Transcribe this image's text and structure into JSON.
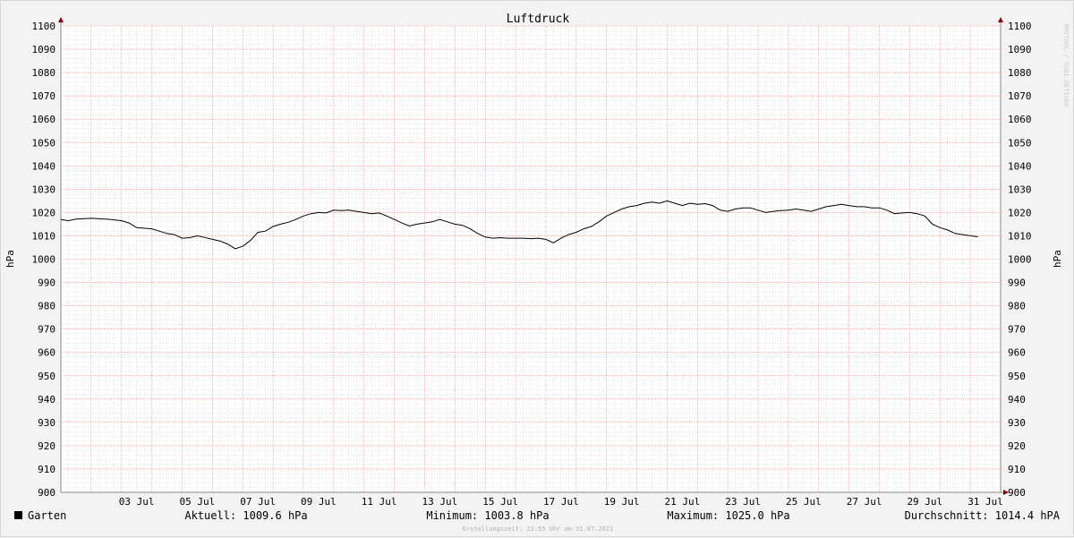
{
  "chart_data": {
    "type": "line",
    "title": "Luftdruck",
    "ylabel": "hPa",
    "ylim": [
      900,
      1100
    ],
    "yticks": [
      900,
      910,
      920,
      930,
      940,
      950,
      960,
      970,
      980,
      990,
      1000,
      1010,
      1020,
      1030,
      1040,
      1050,
      1060,
      1070,
      1080,
      1090,
      1100
    ],
    "xlim": [
      "2021-07-01 00:00",
      "2021-08-01 00:00"
    ],
    "xticks": [
      {
        "date": "2021-07-03",
        "label": "03 Jul"
      },
      {
        "date": "2021-07-05",
        "label": "05 Jul"
      },
      {
        "date": "2021-07-07",
        "label": "07 Jul"
      },
      {
        "date": "2021-07-09",
        "label": "09 Jul"
      },
      {
        "date": "2021-07-11",
        "label": "11 Jul"
      },
      {
        "date": "2021-07-13",
        "label": "13 Jul"
      },
      {
        "date": "2021-07-15",
        "label": "15 Jul"
      },
      {
        "date": "2021-07-17",
        "label": "17 Jul"
      },
      {
        "date": "2021-07-19",
        "label": "19 Jul"
      },
      {
        "date": "2021-07-21",
        "label": "21 Jul"
      },
      {
        "date": "2021-07-23",
        "label": "23 Jul"
      },
      {
        "date": "2021-07-25",
        "label": "25 Jul"
      },
      {
        "date": "2021-07-27",
        "label": "27 Jul"
      },
      {
        "date": "2021-07-29",
        "label": "29 Jul"
      },
      {
        "date": "2021-07-31",
        "label": "31 Jul"
      }
    ],
    "grid": true,
    "series": [
      {
        "name": "Garten",
        "color": "#000000",
        "points": [
          {
            "x": "2021-07-01 00:00",
            "y": 1017.0
          },
          {
            "x": "2021-07-01 06:00",
            "y": 1016.5
          },
          {
            "x": "2021-07-01 12:00",
            "y": 1017.2
          },
          {
            "x": "2021-07-02 00:00",
            "y": 1017.5
          },
          {
            "x": "2021-07-02 12:00",
            "y": 1017.2
          },
          {
            "x": "2021-07-03 00:00",
            "y": 1016.5
          },
          {
            "x": "2021-07-03 06:00",
            "y": 1015.5
          },
          {
            "x": "2021-07-03 12:00",
            "y": 1013.5
          },
          {
            "x": "2021-07-04 00:00",
            "y": 1013.0
          },
          {
            "x": "2021-07-04 06:00",
            "y": 1012.0
          },
          {
            "x": "2021-07-04 12:00",
            "y": 1011.0
          },
          {
            "x": "2021-07-04 18:00",
            "y": 1010.5
          },
          {
            "x": "2021-07-05 00:00",
            "y": 1009.0
          },
          {
            "x": "2021-07-05 06:00",
            "y": 1009.2
          },
          {
            "x": "2021-07-05 12:00",
            "y": 1010.0
          },
          {
            "x": "2021-07-05 18:00",
            "y": 1009.3
          },
          {
            "x": "2021-07-06 00:00",
            "y": 1008.5
          },
          {
            "x": "2021-07-06 06:00",
            "y": 1007.8
          },
          {
            "x": "2021-07-06 12:00",
            "y": 1006.5
          },
          {
            "x": "2021-07-06 18:00",
            "y": 1004.5
          },
          {
            "x": "2021-07-07 00:00",
            "y": 1005.5
          },
          {
            "x": "2021-07-07 06:00",
            "y": 1008.0
          },
          {
            "x": "2021-07-07 12:00",
            "y": 1011.5
          },
          {
            "x": "2021-07-07 18:00",
            "y": 1012.0
          },
          {
            "x": "2021-07-08 00:00",
            "y": 1014.0
          },
          {
            "x": "2021-07-08 06:00",
            "y": 1015.0
          },
          {
            "x": "2021-07-08 12:00",
            "y": 1015.8
          },
          {
            "x": "2021-07-08 18:00",
            "y": 1017.0
          },
          {
            "x": "2021-07-09 00:00",
            "y": 1018.5
          },
          {
            "x": "2021-07-09 06:00",
            "y": 1019.5
          },
          {
            "x": "2021-07-09 12:00",
            "y": 1020.0
          },
          {
            "x": "2021-07-09 18:00",
            "y": 1019.8
          },
          {
            "x": "2021-07-10 00:00",
            "y": 1021.0
          },
          {
            "x": "2021-07-10 06:00",
            "y": 1020.8
          },
          {
            "x": "2021-07-10 12:00",
            "y": 1021.0
          },
          {
            "x": "2021-07-10 18:00",
            "y": 1020.5
          },
          {
            "x": "2021-07-11 00:00",
            "y": 1020.0
          },
          {
            "x": "2021-07-11 06:00",
            "y": 1019.5
          },
          {
            "x": "2021-07-11 12:00",
            "y": 1019.8
          },
          {
            "x": "2021-07-11 18:00",
            "y": 1018.5
          },
          {
            "x": "2021-07-12 00:00",
            "y": 1017.0
          },
          {
            "x": "2021-07-12 06:00",
            "y": 1015.5
          },
          {
            "x": "2021-07-12 12:00",
            "y": 1014.2
          },
          {
            "x": "2021-07-12 18:00",
            "y": 1015.0
          },
          {
            "x": "2021-07-13 00:00",
            "y": 1015.5
          },
          {
            "x": "2021-07-13 06:00",
            "y": 1016.0
          },
          {
            "x": "2021-07-13 12:00",
            "y": 1017.0
          },
          {
            "x": "2021-07-13 18:00",
            "y": 1016.0
          },
          {
            "x": "2021-07-14 00:00",
            "y": 1015.0
          },
          {
            "x": "2021-07-14 06:00",
            "y": 1014.5
          },
          {
            "x": "2021-07-14 12:00",
            "y": 1013.0
          },
          {
            "x": "2021-07-14 18:00",
            "y": 1011.0
          },
          {
            "x": "2021-07-15 00:00",
            "y": 1009.5
          },
          {
            "x": "2021-07-15 06:00",
            "y": 1009.0
          },
          {
            "x": "2021-07-15 12:00",
            "y": 1009.2
          },
          {
            "x": "2021-07-15 18:00",
            "y": 1009.0
          },
          {
            "x": "2021-07-16 00:00",
            "y": 1009.0
          },
          {
            "x": "2021-07-16 06:00",
            "y": 1009.0
          },
          {
            "x": "2021-07-16 12:00",
            "y": 1008.8
          },
          {
            "x": "2021-07-16 18:00",
            "y": 1009.0
          },
          {
            "x": "2021-07-17 00:00",
            "y": 1008.5
          },
          {
            "x": "2021-07-17 06:00",
            "y": 1007.0
          },
          {
            "x": "2021-07-17 12:00",
            "y": 1009.0
          },
          {
            "x": "2021-07-17 18:00",
            "y": 1010.5
          },
          {
            "x": "2021-07-18 00:00",
            "y": 1011.5
          },
          {
            "x": "2021-07-18 06:00",
            "y": 1013.0
          },
          {
            "x": "2021-07-18 12:00",
            "y": 1014.0
          },
          {
            "x": "2021-07-18 18:00",
            "y": 1016.0
          },
          {
            "x": "2021-07-19 00:00",
            "y": 1018.5
          },
          {
            "x": "2021-07-19 06:00",
            "y": 1020.0
          },
          {
            "x": "2021-07-19 12:00",
            "y": 1021.5
          },
          {
            "x": "2021-07-19 18:00",
            "y": 1022.5
          },
          {
            "x": "2021-07-20 00:00",
            "y": 1023.0
          },
          {
            "x": "2021-07-20 06:00",
            "y": 1024.0
          },
          {
            "x": "2021-07-20 12:00",
            "y": 1024.5
          },
          {
            "x": "2021-07-20 18:00",
            "y": 1024.0
          },
          {
            "x": "2021-07-21 00:00",
            "y": 1025.0
          },
          {
            "x": "2021-07-21 06:00",
            "y": 1024.0
          },
          {
            "x": "2021-07-21 12:00",
            "y": 1023.0
          },
          {
            "x": "2021-07-21 18:00",
            "y": 1024.0
          },
          {
            "x": "2021-07-22 00:00",
            "y": 1023.5
          },
          {
            "x": "2021-07-22 06:00",
            "y": 1023.8
          },
          {
            "x": "2021-07-22 12:00",
            "y": 1023.0
          },
          {
            "x": "2021-07-22 18:00",
            "y": 1021.0
          },
          {
            "x": "2021-07-23 00:00",
            "y": 1020.5
          },
          {
            "x": "2021-07-23 06:00",
            "y": 1021.5
          },
          {
            "x": "2021-07-23 12:00",
            "y": 1022.0
          },
          {
            "x": "2021-07-23 18:00",
            "y": 1022.0
          },
          {
            "x": "2021-07-24 00:00",
            "y": 1021.0
          },
          {
            "x": "2021-07-24 06:00",
            "y": 1020.0
          },
          {
            "x": "2021-07-24 12:00",
            "y": 1020.5
          },
          {
            "x": "2021-07-24 18:00",
            "y": 1020.8
          },
          {
            "x": "2021-07-25 00:00",
            "y": 1021.0
          },
          {
            "x": "2021-07-25 06:00",
            "y": 1021.5
          },
          {
            "x": "2021-07-25 12:00",
            "y": 1021.0
          },
          {
            "x": "2021-07-25 18:00",
            "y": 1020.5
          },
          {
            "x": "2021-07-26 00:00",
            "y": 1021.5
          },
          {
            "x": "2021-07-26 06:00",
            "y": 1022.5
          },
          {
            "x": "2021-07-26 12:00",
            "y": 1023.0
          },
          {
            "x": "2021-07-26 18:00",
            "y": 1023.5
          },
          {
            "x": "2021-07-27 00:00",
            "y": 1023.0
          },
          {
            "x": "2021-07-27 06:00",
            "y": 1022.5
          },
          {
            "x": "2021-07-27 12:00",
            "y": 1022.5
          },
          {
            "x": "2021-07-27 18:00",
            "y": 1022.0
          },
          {
            "x": "2021-07-28 00:00",
            "y": 1022.0
          },
          {
            "x": "2021-07-28 06:00",
            "y": 1021.0
          },
          {
            "x": "2021-07-28 12:00",
            "y": 1019.5
          },
          {
            "x": "2021-07-28 18:00",
            "y": 1019.8
          },
          {
            "x": "2021-07-29 00:00",
            "y": 1020.0
          },
          {
            "x": "2021-07-29 06:00",
            "y": 1019.5
          },
          {
            "x": "2021-07-29 12:00",
            "y": 1018.5
          },
          {
            "x": "2021-07-29 18:00",
            "y": 1015.0
          },
          {
            "x": "2021-07-30 00:00",
            "y": 1013.5
          },
          {
            "x": "2021-07-30 06:00",
            "y": 1012.5
          },
          {
            "x": "2021-07-30 12:00",
            "y": 1011.0
          },
          {
            "x": "2021-07-30 18:00",
            "y": 1010.5
          },
          {
            "x": "2021-07-31 00:00",
            "y": 1010.0
          },
          {
            "x": "2021-07-31 06:00",
            "y": 1009.6
          }
        ]
      }
    ]
  },
  "legend": {
    "series_name": "Garten",
    "swatch_color": "#000000",
    "current": "Aktuell: 1009.6 hPa",
    "minimum": "Minimum: 1003.8 hPa",
    "maximum": "Maximum: 1025.0 hPa",
    "average": "Durchschnitt: 1014.4 hPA"
  },
  "footer": {
    "created": "Erstellungszeit: 23:55 Uhr am 31.07.2021"
  },
  "watermark": "RRDTOOL / TOBI OETIKER",
  "colors": {
    "background": "#f3f3f3",
    "plot_background": "#ffffff",
    "major_grid": "#e08a8a",
    "minor_grid": "#c8c8c8",
    "axis": "#888888",
    "arrow": "#8b0000",
    "text": "#000000",
    "watermark": "#cccccc"
  }
}
